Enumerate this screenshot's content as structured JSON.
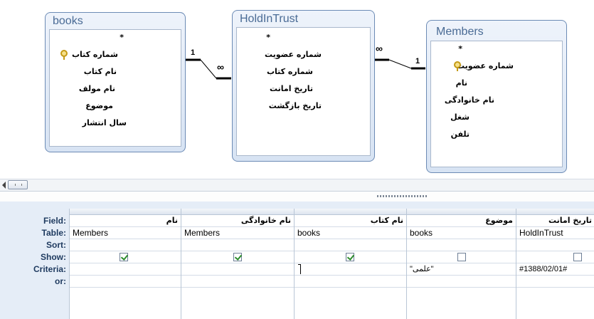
{
  "tables": [
    {
      "title": "books",
      "fields": [
        "*",
        "شماره کتاب",
        "نام کتاب",
        "نام مولف",
        "موضوع",
        "سال انتشار"
      ],
      "key_field_index": 1
    },
    {
      "title": "HoldInTrust",
      "fields": [
        "*",
        "شماره عضويت",
        "شماره کتاب",
        "تاريخ امانت",
        "تاريخ بازگشت"
      ]
    },
    {
      "title": "Members",
      "fields": [
        "*",
        "شماره عضويت",
        "نام",
        "نام خانوادگی",
        "شغل",
        "تلفن"
      ],
      "key_field_index": 1
    }
  ],
  "relationships": [
    {
      "one_label": "1",
      "many_label": "∞"
    },
    {
      "one_label": "1",
      "many_label": "∞"
    }
  ],
  "grid": {
    "row_labels": [
      "Field:",
      "Table:",
      "Sort:",
      "Show:",
      "Criteria:",
      "or:"
    ],
    "columns": [
      {
        "field": "نام",
        "table": "Members",
        "sort": "",
        "show": true,
        "criteria": ""
      },
      {
        "field": "نام خانوادگی",
        "table": "Members",
        "sort": "",
        "show": true,
        "criteria": ""
      },
      {
        "field": "نام کتاب",
        "table": "books",
        "sort": "",
        "show": true,
        "criteria": ""
      },
      {
        "field": "موضوع",
        "table": "books",
        "sort": "",
        "show": false,
        "criteria": "\"علمی\""
      },
      {
        "field": "تاريخ امانت",
        "table": "HoldInTrust",
        "sort": "",
        "show": false,
        "criteria": "#1388/02/01#"
      }
    ]
  },
  "colors": {
    "table_border": "#6c8bb5",
    "table_title": "#4a6b95",
    "grid_bg": "#e5edf7",
    "check": "#2c8c2c"
  }
}
